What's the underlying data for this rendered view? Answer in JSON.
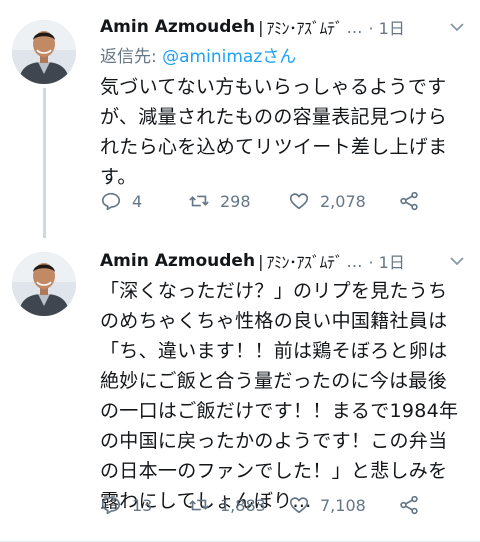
{
  "tweets": [
    {
      "author_name": "Amin Azmoudeh",
      "handle_separator": "|",
      "author_kana": "ｱﾐﾝ･ｱｽﾞﾑﾃﾞ",
      "ellipsis": "…",
      "timestamp": "· 1日",
      "reply_prefix": "返信先: ",
      "reply_handle": "@aminimazさん",
      "text": "気づいてない方もいらっしゃるようですが、減量されたものの容量表記見つけられたら心を込めてリツイート差し上げます。",
      "replies": "4",
      "retweets": "298",
      "likes": "2,078"
    },
    {
      "author_name": "Amin Azmoudeh",
      "handle_separator": "|",
      "author_kana": "ｱﾐﾝ･ｱｽﾞﾑﾃﾞ",
      "ellipsis": "…",
      "timestamp": "· 1日",
      "text": "「深くなっただけ？」のリプを見たうちのめちゃくちゃ性格の良い中国籍社員は「ち、違います！！前は鶏そぼろと卵は絶妙にご飯と合う量だったのに今は最後の一口はご飯だけです！！まるで1984年の中国に戻ったかのようです！この弁当の日本一のファンでした！」と悲しみを露わにしてしょんぼり…",
      "replies": "13",
      "retweets": "1,883",
      "likes": "7,108"
    }
  ],
  "colors": {
    "text": "#14171a",
    "secondary": "#657786",
    "link": "#1da1f2",
    "thread_line": "#cfd9de"
  },
  "icons": [
    "avatar",
    "chevron-down-icon",
    "reply-icon",
    "retweet-icon",
    "like-icon",
    "share-icon"
  ]
}
